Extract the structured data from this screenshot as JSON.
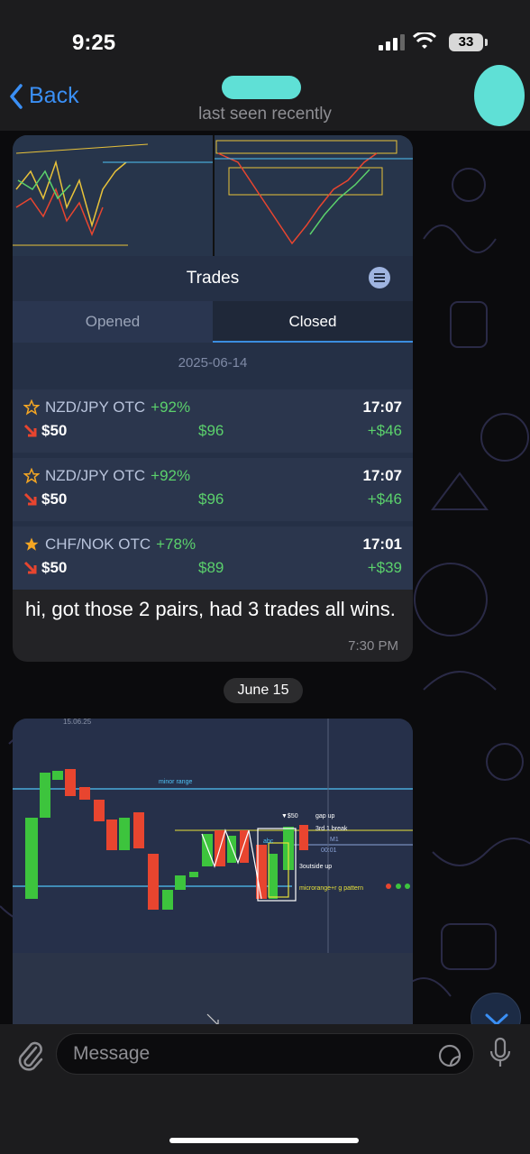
{
  "status_bar": {
    "time": "9:25",
    "battery": "33"
  },
  "header": {
    "back_label": "Back",
    "subtitle": "last seen recently"
  },
  "trades_card": {
    "title": "Trades",
    "tabs": [
      "Opened",
      "Closed"
    ],
    "active_tab": "Closed",
    "date": "2025-06-14",
    "rows": [
      {
        "pair": "NZD/JPY OTC",
        "percent": "+92%",
        "stake": "$50",
        "payout": "$96",
        "time": "17:07",
        "profit": "+$46",
        "starred": false
      },
      {
        "pair": "NZD/JPY OTC",
        "percent": "+92%",
        "stake": "$50",
        "payout": "$96",
        "time": "17:07",
        "profit": "+$46",
        "starred": false
      },
      {
        "pair": "CHF/NOK OTC",
        "percent": "+78%",
        "stake": "$50",
        "payout": "$89",
        "time": "17:01",
        "profit": "+$39",
        "starred": true
      }
    ]
  },
  "message1": {
    "text": "hi, got those 2 pairs, had 3 trades all wins.",
    "time": "7:30 PM"
  },
  "date_separator": "June 15",
  "chart_screenshot": {
    "date_label": "15.06.25",
    "annotations": {
      "minor_range": "minor range",
      "stake": "▼$50",
      "gap_up": "gap up",
      "break": "3rd 1 break",
      "timeframe": "M1",
      "timer": "00:01",
      "abc": "abc",
      "outside_up": "3outside up",
      "pattern": "microrange+r g pattern"
    }
  },
  "input": {
    "placeholder": "Message"
  },
  "colors": {
    "accent": "#3a8ff5",
    "profit_green": "#5bd16c",
    "loss_red": "#e8452f",
    "teal_redaction": "#5fe0d6"
  }
}
